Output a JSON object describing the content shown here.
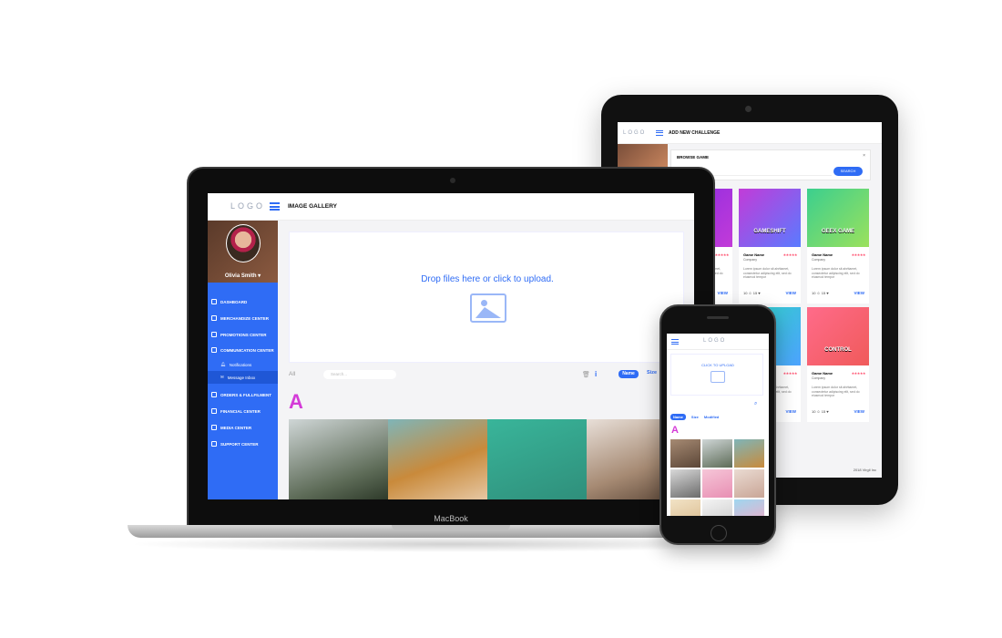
{
  "tablet": {
    "logo": "LOGO",
    "title": "ADD NEW CHALLENGE",
    "modal": {
      "title": "BROWSE GAME",
      "close": "×",
      "placeholder": "SELECT GENRE",
      "button": "SEARCH"
    },
    "cards": [
      {
        "logo_text": "GAMESHIFT",
        "name": "Game Name",
        "company": "Company",
        "stars": "★★★★★",
        "desc": "Lorem ipsum dolor sit ahrttamet, consectetur adipiscing elit, sed do eiusmod tempor",
        "meta": "10 ☺ 15 ♥",
        "view": "VIEW",
        "color": "#c23bd8"
      },
      {
        "logo_text": "GEEX GAME",
        "name": "Game Name",
        "company": "Company",
        "stars": "★★★★★",
        "desc": "Lorem ipsum dolor sit ahrttamet, consectetur adipiscing elit, sed do eiusmod tempor",
        "meta": "10 ☺ 15 ♥",
        "view": "VIEW",
        "color": "#3bcf8e"
      },
      {
        "logo_text": "CONTROL",
        "name": "Game Name",
        "company": "Company",
        "stars": "★★★★★",
        "desc": "Lorem ipsum dolor sit ahrttamet, consectetur adipiscing elit, sed do eiusmod tempor",
        "meta": "10 ☺ 15 ♥",
        "view": "VIEW",
        "color": "#f05a5a"
      }
    ],
    "footer": "2018 Virgil Inc"
  },
  "laptop": {
    "brand": "MacBook",
    "logo": "LOGO",
    "title": "IMAGE GALLERY",
    "user": "Olivia Smith ▾",
    "nav": [
      "DASHBOARD",
      "MERCHANDIZE CENTER",
      "PROMOTIONS CENTER",
      "COMMUNICATION CENTER"
    ],
    "sub": [
      "Notifications",
      "Message Inbox"
    ],
    "nav2": [
      "ORDERS & FULLFILMENT",
      "FINANCIAL CENTER",
      "MEDIA CENTER",
      "SUPPORT CENTER"
    ],
    "drop_text": "Drop files here or click to upload.",
    "filter_all": "All",
    "search_placeholder": "Search...",
    "sort_name": "Name",
    "sort_size": "Size",
    "letter": "A"
  },
  "phone": {
    "logo": "LOGO",
    "upload_text": "CLICK TO UPLOAD",
    "tabs": [
      "Name",
      "Size",
      "Modified"
    ],
    "letter": "A"
  },
  "colors": {
    "accent": "#2f6cf5",
    "letter": "#d43bd8"
  }
}
